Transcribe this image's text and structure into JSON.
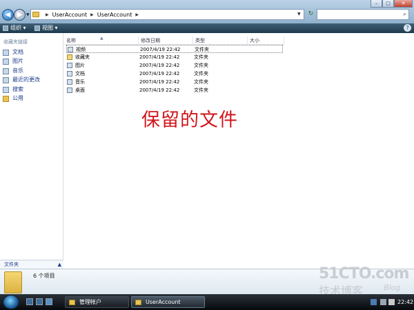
{
  "window": {
    "buttons": {
      "minimize": "–",
      "maximize": "□",
      "close": "✕"
    },
    "address": {
      "crumbs": [
        "UserAccount",
        "UserAccount"
      ]
    },
    "search_placeholder": ""
  },
  "toolbar": {
    "organize": "组织 ▾",
    "views": "视图 ▾",
    "help": "?"
  },
  "sidebar": {
    "header": "收藏夹链接",
    "items": [
      {
        "label": "文档",
        "icon": "document-icon"
      },
      {
        "label": "图片",
        "icon": "picture-icon"
      },
      {
        "label": "音乐",
        "icon": "music-icon"
      },
      {
        "label": "最近的更改",
        "icon": "recent-icon"
      },
      {
        "label": "搜索",
        "icon": "search-icon"
      },
      {
        "label": "公用",
        "icon": "public-folder-icon"
      }
    ],
    "folders_label": "文件夹",
    "folders_chevron": "▲"
  },
  "filelist": {
    "columns": [
      "名称",
      "修改日期",
      "类型",
      "大小"
    ],
    "sort_indicator": "▲",
    "rows": [
      {
        "name": "视频",
        "date": "2007/4/19 22:42",
        "type": "文件夹"
      },
      {
        "name": "收藏夹",
        "date": "2007/4/19 22:42",
        "type": "文件夹"
      },
      {
        "name": "图片",
        "date": "2007/4/19 22:42",
        "type": "文件夹"
      },
      {
        "name": "文档",
        "date": "2007/4/19 22:42",
        "type": "文件夹"
      },
      {
        "name": "音乐",
        "date": "2007/4/19 22:42",
        "type": "文件夹"
      },
      {
        "name": "桌面",
        "date": "2007/4/19 22:42",
        "type": "文件夹"
      }
    ],
    "caption": "保留的文件"
  },
  "details": {
    "item_count": "6 个项目"
  },
  "watermark": {
    "main": "51CTO.com",
    "sub": "技术博客",
    "blog": "Blog"
  },
  "taskbar": {
    "tasks": [
      {
        "label": "管理帐户"
      },
      {
        "label": "UserAccount"
      }
    ],
    "clock": "22:42"
  },
  "colors": {
    "caption": "#d0161b",
    "toolbar": "#2b4a60"
  }
}
